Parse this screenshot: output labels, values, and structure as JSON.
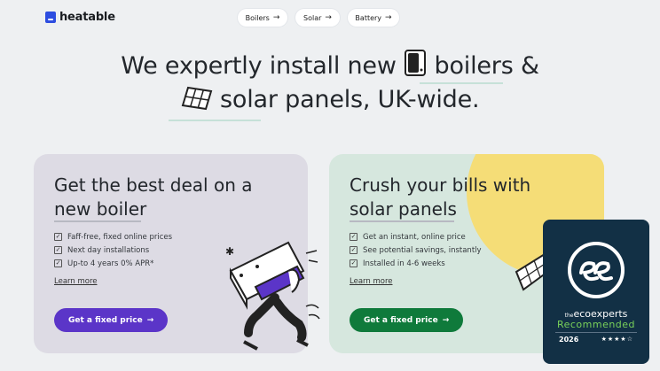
{
  "header": {
    "brand": "heatable",
    "nav": [
      {
        "label": "Boilers",
        "arrow": "→"
      },
      {
        "label": "Solar",
        "arrow": "→"
      },
      {
        "label": "Battery",
        "arrow": "→"
      }
    ]
  },
  "hero": {
    "line1_a": "We expertly install new",
    "line1_b": "boilers &",
    "line2": "solar panels, UK-wide."
  },
  "cards": {
    "boiler": {
      "title_line1": "Get the best deal on a",
      "title_line2": "new boiler",
      "bullets": [
        "Faff-free, fixed online prices",
        "Next day installations",
        "Up-to 4 years 0% APR*"
      ],
      "learn_more": "Learn more",
      "cta": "Get a fixed price",
      "cta_arrow": "→",
      "color": "#5b35c8"
    },
    "solar": {
      "title_line1": "Crush your bills with",
      "title_line2": "solar panels",
      "bullets": [
        "Get an instant, online price",
        "See potential savings, instantly",
        "Installed in 4-6 weeks"
      ],
      "learn_more": "Learn more",
      "cta": "Get a fixed price",
      "cta_arrow": "→",
      "color": "#0f7a3b"
    }
  },
  "badge": {
    "brand_prefix": "the",
    "brand_name": "ecoexperts",
    "status": "Recommended",
    "year": "2026",
    "stars": "★★★★☆"
  },
  "icons": {
    "check": "✓"
  }
}
